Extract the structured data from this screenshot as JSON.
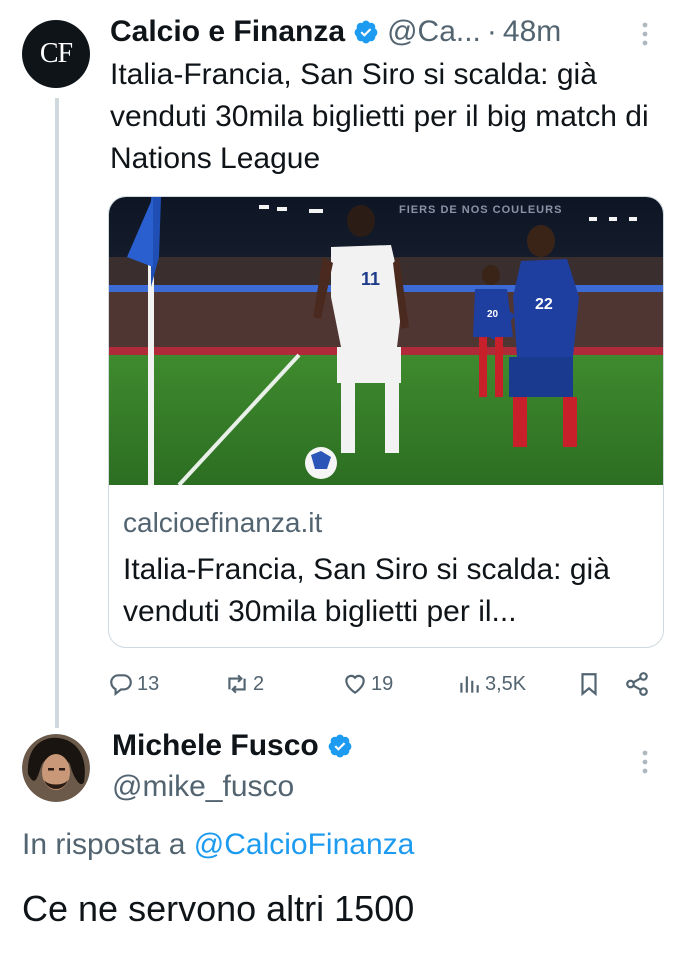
{
  "colors": {
    "accent": "#1d9bf0",
    "text": "#0f1419",
    "muted": "#536471",
    "border": "#cfd9de"
  },
  "tweet": {
    "avatar_text": "CF",
    "author_name": "Calcio e Finanza",
    "handle": "@Ca...",
    "separator": "·",
    "time": "48m",
    "more_icon": "vertical-dots-icon",
    "text": "Italia-Francia, San Siro si scalda: già venduti 30mila biglietti per il big match di Nations League",
    "card": {
      "image": "football-match-photo",
      "image_banner_text": "FIERS DE NOS COULEURS",
      "jersey_italy": "11",
      "jersey_france_left": "20",
      "jersey_france_right": "22",
      "domain": "calcioefinanza.it",
      "title": "Italia-Francia, San Siro si scalda: già venduti 30mila biglietti per il..."
    },
    "actions": {
      "replies": "13",
      "retweets": "2",
      "likes": "19",
      "views": "3,5K"
    }
  },
  "reply": {
    "author_name": "Michele Fusco",
    "handle": "@mike_fusco",
    "reply_to_prefix": "In risposta a",
    "reply_to_handle": "@CalcioFinanza",
    "text": "Ce ne servono altri 1500"
  }
}
